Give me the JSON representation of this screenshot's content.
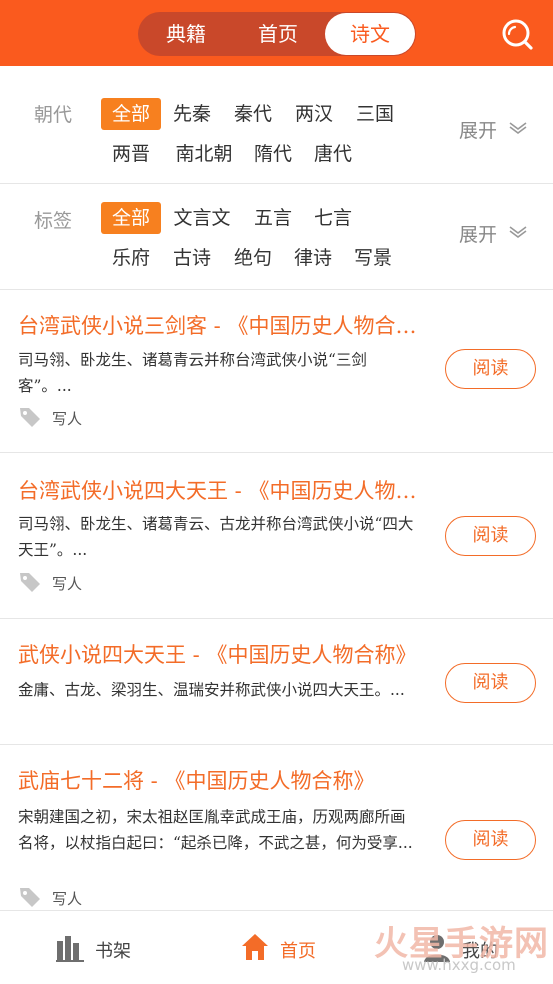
{
  "header": {
    "tabs": [
      {
        "label": "典籍",
        "active": false
      },
      {
        "label": "首页",
        "active": false
      },
      {
        "label": "诗文",
        "active": true
      }
    ],
    "search_icon": "search-icon",
    "accent_color": "#fa5a1e"
  },
  "filters": {
    "dynasty": {
      "label": "朝代",
      "options": [
        "全部",
        "先秦",
        "秦代",
        "两汉",
        "三国",
        "两晋",
        "南北朝",
        "隋代",
        "唐代"
      ],
      "selected": "全部",
      "expand_label": "展开"
    },
    "tags": {
      "label": "标签",
      "options": [
        "全部",
        "文言文",
        "五言",
        "七言",
        "乐府",
        "古诗",
        "绝句",
        "律诗",
        "写景"
      ],
      "selected": "全部",
      "expand_label": "展开"
    }
  },
  "items": [
    {
      "title": "台湾武侠小说三剑客 - 《中国历史人物合称》",
      "desc": "司马翎、卧龙生、诸葛青云并称台湾武侠小说“三剑客”。...",
      "tag": "写人",
      "read_label": "阅读"
    },
    {
      "title": "台湾武侠小说四大天王 - 《中国历史人物合称》",
      "desc": "司马翎、卧龙生、诸葛青云、古龙并称台湾武侠小说“四大天王”。...",
      "tag": "写人",
      "read_label": "阅读"
    },
    {
      "title": "武侠小说四大天王 - 《中国历史人物合称》",
      "desc": "金庸、古龙、梁羽生、温瑞安并称武侠小说四大天王。...",
      "tag": "",
      "read_label": "阅读"
    },
    {
      "title": "武庙七十二将 - 《中国历史人物合称》",
      "desc": "宋朝建国之初，宋太祖赵匡胤幸武成王庙，历观两廊所画名将，以杖指白起曰：“起杀已降，不武之甚，何为受享...",
      "tag": "写人",
      "read_label": "阅读"
    }
  ],
  "tabbar": {
    "tabs": [
      {
        "label": "书架",
        "icon": "bookshelf-icon",
        "active": false
      },
      {
        "label": "首页",
        "icon": "home-icon",
        "active": true
      },
      {
        "label": "我的",
        "icon": "user-icon",
        "active": false
      }
    ]
  },
  "watermark": {
    "text": "火星手游网",
    "url": "www.hxxg.com"
  }
}
